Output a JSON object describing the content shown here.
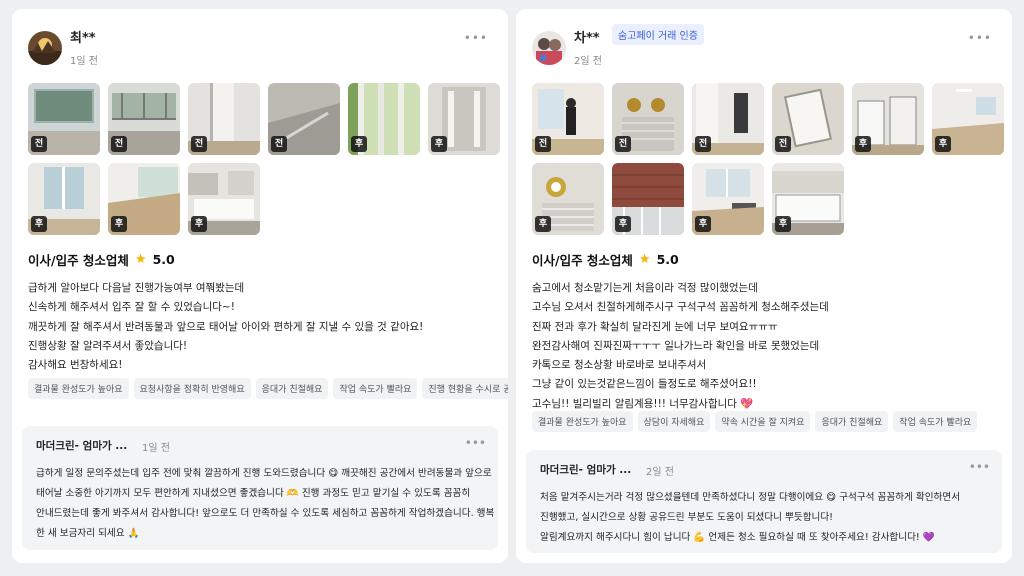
{
  "reviews": [
    {
      "user": "최**",
      "date": "1일 전",
      "badge": "",
      "more_icon": "more-icon",
      "photos": [
        "전",
        "전",
        "전",
        "전",
        "후",
        "후",
        "후",
        "후",
        "후"
      ],
      "service": "이사/입주 청소업체",
      "rating": "5.0",
      "lines": [
        "급하게 알아보다 다음날 진행가능여부 여쭤봤는데",
        "신속하게 해주셔서 입주 잘 할 수 있었습니다~!",
        "깨끗하게 잘 해주셔서 반려동물과 앞으로 태어날 아이와 편하게 잘 지낼 수 있을 것 같아요!",
        "진행상황 잘 알려주셔서 좋았습니다!",
        "감사해요 번창하세요!"
      ],
      "chips": [
        "결과물 완성도가 높아요",
        "요청사항을 정확히 반영해요",
        "응대가 친절해요",
        "작업 속도가 빨라요",
        "진행 현황을 수시로 공유해요"
      ],
      "reply": {
        "name": "마더크린- 엄마가 ...",
        "date": "1일 전",
        "lines": [
          "급하게 일정 문의주셨는데 입주 전에 맞춰 깔끔하게 진행 도와드렸습니다 😋  깨끗해진 공간에서 반려동물과 앞으로",
          "태어날 소중한 아기까지 모두 편안하게 지내셨으면 좋겠습니다 🫶  진행 과정도 믿고 맡기실 수 있도록 꼼꼼히",
          "안내드렸는데 좋게 봐주셔서 감사합니다! 앞으로도 더 만족하실 수 있도록 세심하고 꼼꼼하게 작업하겠습니다. 행복",
          "한 새 보금자리 되세요 🙏"
        ]
      }
    },
    {
      "user": "차**",
      "date": "2일 전",
      "badge": "숨고페이 거래 인증",
      "more_icon": "more-icon",
      "photos": [
        "전",
        "전",
        "전",
        "전",
        "후",
        "후",
        "후",
        "후",
        "후",
        "후"
      ],
      "service": "이사/입주 청소업체",
      "rating": "5.0",
      "lines": [
        "숨고에서 청소맡기는게 처음이라 걱정 많이했었는데",
        "고수님 오셔서 친절하게해주시구 구석구석 꼼꼼하게 청소해주셨는데",
        "진짜 전과 후가 확실히 달라진게 눈에 너무 보여요ㅠㅠㅠ",
        "완전감사해여 진짜진짜ㅜㅜㅜ 일나가느라 확인을 바로 못했었는데",
        "카톡으로 청소상황 바로바로 보내주셔서",
        "그냥 같이 있는것같은느낌이 들정도로 해주셨어요!!",
        "고수님!! 빌리빌리 알림계용!!! 너무감사합니다 💖"
      ],
      "chips": [
        "결과물 완성도가 높아요",
        "상담이 자세해요",
        "약속 시간을 잘 지켜요",
        "응대가 친절해요",
        "작업 속도가 빨라요"
      ],
      "reply": {
        "name": "마더크린- 엄마가 ...",
        "date": "2일 전",
        "lines": [
          "처음 맡겨주시는거라 걱정 많으셨을텐데 만족하셨다니 정말 다행이에요 😋  구석구석 꼼꼼하게 확인하면서",
          "진행했고, 실시간으로 상황 공유드린 부분도 도움이 되셨다니 뿌듯합니다!",
          "알림계요까지 해주시다니 힘이 납니다 💪  언제든 청소 필요하실 때 또 찾아주세요! 감사합니다! 💜"
        ]
      }
    }
  ],
  "colors": {
    "accent_badge": "#3b5bdb",
    "star": "#f6b400",
    "tag_bg": "#141414"
  }
}
